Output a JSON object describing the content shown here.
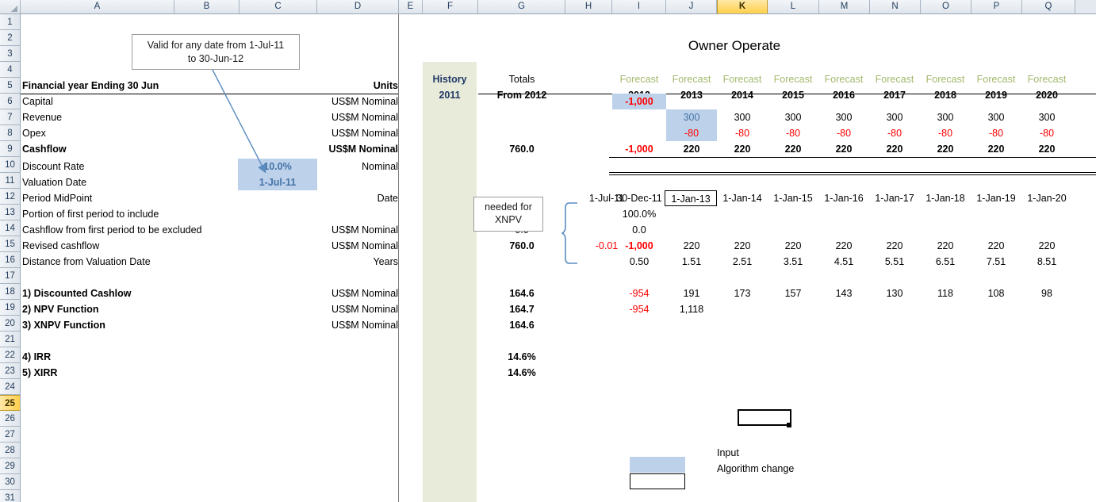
{
  "sheet": {
    "title": "Owner Operate",
    "active_cell": "K25",
    "columns": [
      "A",
      "B",
      "C",
      "D",
      "E",
      "F",
      "G",
      "H",
      "I",
      "J",
      "K",
      "L",
      "M",
      "N",
      "O",
      "P",
      "Q"
    ],
    "active_column": "K",
    "rows": [
      "1",
      "2",
      "3",
      "4",
      "5",
      "6",
      "7",
      "8",
      "9",
      "10",
      "11",
      "12",
      "13",
      "14",
      "15",
      "16",
      "17",
      "18",
      "19",
      "20",
      "21",
      "22",
      "23",
      "24",
      "25",
      "26",
      "27",
      "28",
      "29",
      "30",
      "31"
    ],
    "active_row": "25"
  },
  "callouts": {
    "valid_line1": "Valid for any date from 1-Jul-11",
    "valid_line2": "to 30-Jun-12",
    "xnpv_line1": "needed for",
    "xnpv_line2": "XNPV"
  },
  "headers": {
    "row5_label": "Financial year Ending 30 Jun",
    "units": "Units",
    "history_label": "History",
    "history_year": "2011",
    "totals_label": "Totals",
    "totals_from": "From 2012",
    "forecast_label": "Forecast",
    "forecast_years": [
      "2012",
      "2013",
      "2014",
      "2015",
      "2016",
      "2017",
      "2018",
      "2019",
      "2020"
    ]
  },
  "labels": {
    "capital": "Capital",
    "revenue": "Revenue",
    "opex": "Opex",
    "cashflow": "Cashflow",
    "discount_rate": "Discount Rate",
    "valuation_date": "Valuation Date",
    "period_midpoint": "Period MidPoint",
    "portion_first_period": "Portion of first period to include",
    "cashflow_excluded": "Cashflow from first period to be excluded",
    "revised_cashflow": "Revised cashflow",
    "distance_valuation": "Distance from Valuation Date",
    "discounted_cashflow": "1) Discounted Cashlow",
    "npv_function": "2) NPV Function",
    "xnpv_function": "3) XNPV Function",
    "irr": "4) IRR",
    "xirr": "5) XIRR"
  },
  "units": {
    "capital": "US$M Nominal",
    "revenue": "US$M Nominal",
    "opex": "US$M Nominal",
    "cashflow": "US$M Nominal",
    "discount_rate": "Nominal",
    "period_midpoint": "Date",
    "cashflow_excluded": "US$M Nominal",
    "revised_cashflow": "US$M Nominal",
    "distance_valuation": "Years",
    "discounted_cashflow": "US$M Nominal",
    "npv_function": "US$M Nominal",
    "xnpv_function": "US$M Nominal"
  },
  "inputs": {
    "discount_rate_value": "10.0%",
    "valuation_date_value": "1-Jul-11"
  },
  "totals": {
    "cashflow": "760.0",
    "cashflow_excluded": "0.0",
    "revised_cashflow": "760.0",
    "discounted_cashflow": "164.6",
    "npv_function": "164.7",
    "xnpv_function": "164.6",
    "irr": "14.6%",
    "xirr": "14.6%"
  },
  "rows_data": {
    "capital": [
      "-1,000",
      "",
      "",
      "",
      "",
      "",
      "",
      "",
      ""
    ],
    "revenue": [
      "",
      "300",
      "300",
      "300",
      "300",
      "300",
      "300",
      "300",
      "300"
    ],
    "opex": [
      "",
      "-80",
      "-80",
      "-80",
      "-80",
      "-80",
      "-80",
      "-80",
      "-80"
    ],
    "cashflow": [
      "-1,000",
      "220",
      "220",
      "220",
      "220",
      "220",
      "220",
      "220",
      "220"
    ],
    "period_midpoint": [
      "30-Dec-11",
      "1-Jan-13",
      "1-Jan-14",
      "1-Jan-15",
      "1-Jan-16",
      "1-Jan-17",
      "1-Jan-18",
      "1-Jan-19",
      "1-Jan-20"
    ],
    "period_midpoint_h": "1-Jul-11",
    "portion_first_period": "100.0%",
    "cashflow_excluded_i": "0.0",
    "revised_cashflow_h": "-0.01",
    "revised_cashflow": [
      "-1,000",
      "220",
      "220",
      "220",
      "220",
      "220",
      "220",
      "220",
      "220"
    ],
    "distance": [
      "0.50",
      "1.51",
      "2.51",
      "3.51",
      "4.51",
      "5.51",
      "6.51",
      "7.51",
      "8.51"
    ],
    "discounted_cashflow": [
      "-954",
      "191",
      "173",
      "157",
      "143",
      "130",
      "118",
      "108",
      "98"
    ],
    "npv_function": [
      "-954",
      "1,118"
    ]
  },
  "legend": {
    "input_label": "Input",
    "algorithm_label": "Algorithm change"
  },
  "colors": {
    "input_fill": "#bdd2ea",
    "history_fill": "#e8eada",
    "forecast_text": "#a3b86c",
    "negative_text": "#ff0000",
    "input_text": "#4472a8",
    "active_header": "#ffcf4a"
  }
}
